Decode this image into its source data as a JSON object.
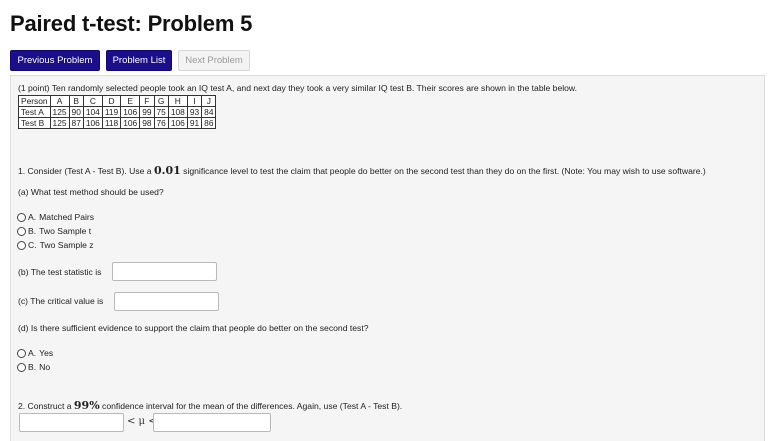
{
  "page": {
    "title": "Paired t-test: Problem 5"
  },
  "nav": {
    "previous": "Previous Problem",
    "list": "Problem List",
    "next": "Next Problem"
  },
  "problem": {
    "intro": "(1 point) Ten randomly selected people took an IQ test A, and next day they took a very similar IQ test B. Their scores are shown in the table below.",
    "table": {
      "header": [
        "Person",
        "A",
        "B",
        "C",
        "D",
        "E",
        "F",
        "G",
        "H",
        "I",
        "J"
      ],
      "rows": [
        [
          "Test A",
          "125",
          "90",
          "104",
          "119",
          "106",
          "99",
          "75",
          "108",
          "93",
          "84"
        ],
        [
          "Test B",
          "125",
          "87",
          "106",
          "118",
          "106",
          "98",
          "76",
          "106",
          "91",
          "86"
        ]
      ]
    },
    "q1_prefix": "1. Consider (Test A - Test B). Use a ",
    "q1_alpha": "0.01",
    "q1_suffix": " significance level to test the claim that people do better on the second test than they do on the first. (Note: You may wish to use software.)",
    "qa": "(a) What test method should be used?",
    "qa_options": [
      {
        "key": "A.",
        "label": "Matched Pairs"
      },
      {
        "key": "B.",
        "label": "Two Sample t"
      },
      {
        "key": "C.",
        "label": "Two Sample z"
      }
    ],
    "qb": "(b) The test statistic is",
    "qc": "(c) The critical value is",
    "qd": "(d) Is there sufficient evidence to support the claim that people do better on the second test?",
    "qd_options": [
      {
        "key": "A.",
        "label": "Yes"
      },
      {
        "key": "B.",
        "label": "No"
      }
    ],
    "q2_prefix": "2. Construct a ",
    "q2_conf": "99%",
    "q2_suffix": " confidence interval for the mean of the differences. Again, use (Test A - Test B).",
    "ci_middle": "< μ <"
  }
}
